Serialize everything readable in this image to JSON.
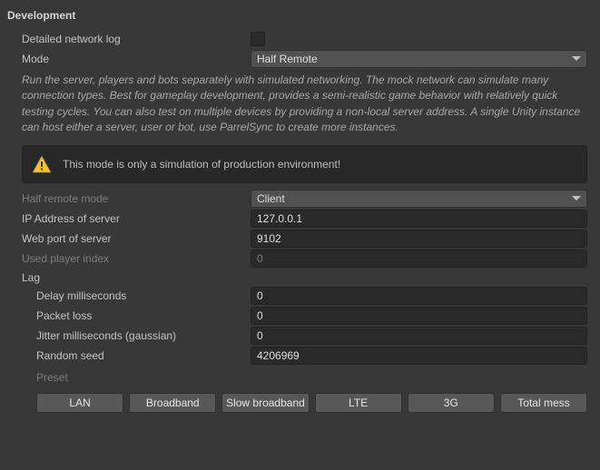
{
  "section_title": "Development",
  "labels": {
    "detailed_log": "Detailed network log",
    "mode": "Mode",
    "half_remote_mode": "Half remote mode",
    "ip": "IP Address of server",
    "webport": "Web port of server",
    "used_player": "Used player index",
    "lag": "Lag",
    "delay": "Delay milliseconds",
    "packet_loss": "Packet loss",
    "jitter": "Jitter milliseconds (gaussian)",
    "seed": "Random seed",
    "preset": "Preset"
  },
  "values": {
    "mode_selected": "Half Remote",
    "half_remote_selected": "Client",
    "ip": "127.0.0.1",
    "webport": "9102",
    "used_player": "0",
    "delay": "0",
    "packet_loss": "0",
    "jitter": "0",
    "seed": "4206969"
  },
  "description": "Run the server, players and bots separately with simulated networking. The mock network can simulate many connection types. Best for gameplay development, provides a semi-realistic game behavior with relatively quick testing cycles. You can also test on multiple devices by providing a non-local server address. A single Unity instance can host either a server, user or bot, use ParrelSync to create more instances.",
  "warning_text": "This mode is only a simulation of production environment!",
  "preset_buttons": {
    "lan": "LAN",
    "broadband": "Broadband",
    "slow_broadband": "Slow broadband",
    "lte": "LTE",
    "g3": "3G",
    "total_mess": "Total mess"
  }
}
